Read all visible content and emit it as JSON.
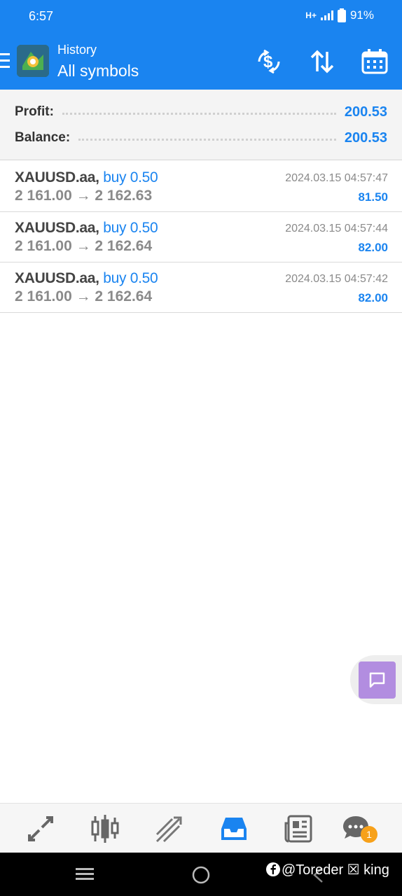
{
  "status": {
    "time": "6:57",
    "network": "H+",
    "battery": "91%"
  },
  "header": {
    "subtitle": "History",
    "title": "All symbols"
  },
  "summary": {
    "profit_label": "Profit:",
    "profit_value": "200.53",
    "balance_label": "Balance:",
    "balance_value": "200.53"
  },
  "deals": [
    {
      "symbol": "XAUUSD.aa,",
      "side": "buy 0.50",
      "prices": "2 161.00 → 2 162.63",
      "time": "2024.03.15 04:57:47",
      "profit": "81.50"
    },
    {
      "symbol": "XAUUSD.aa,",
      "side": "buy 0.50",
      "prices": "2 161.00 → 2 162.64",
      "time": "2024.03.15 04:57:44",
      "profit": "82.00"
    },
    {
      "symbol": "XAUUSD.aa,",
      "side": "buy 0.50",
      "prices": "2 161.00 → 2 162.64",
      "time": "2024.03.15 04:57:42",
      "profit": "82.00"
    }
  ],
  "bottom_nav": {
    "items": [
      "quotes-icon",
      "chart-icon",
      "trade-icon",
      "history-icon",
      "news-icon",
      "chat-icon"
    ],
    "active": "history-icon",
    "chat_badge": "1"
  },
  "watermark": "@Toreder ☒ king",
  "colors": {
    "accent": "#1a84f0",
    "badge": "#f7a11a",
    "fab": "#b28de0"
  }
}
